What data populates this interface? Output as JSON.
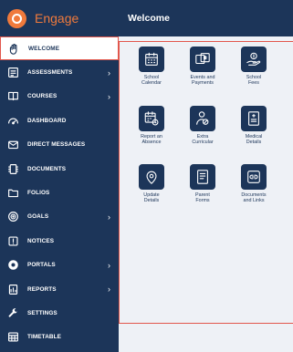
{
  "app": {
    "name": "Engage",
    "brand_color": "#f07a3c",
    "nav_color": "#1c3559",
    "highlight_color": "#e2574c"
  },
  "header": {
    "title": "Welcome"
  },
  "sidebar": {
    "items": [
      {
        "label": "WELCOME",
        "icon": "hand-wave-icon",
        "active": true
      },
      {
        "label": "ASSESSMENTS",
        "icon": "assessment-icon",
        "chevron": true
      },
      {
        "label": "COURSES",
        "icon": "book-icon",
        "chevron": true
      },
      {
        "label": "DASHBOARD",
        "icon": "gauge-icon"
      },
      {
        "label": "DIRECT MESSAGES",
        "icon": "mail-icon"
      },
      {
        "label": "DOCUMENTS",
        "icon": "documents-icon"
      },
      {
        "label": "FOLIOS",
        "icon": "folder-icon"
      },
      {
        "label": "GOALS",
        "icon": "target-icon",
        "chevron": true
      },
      {
        "label": "NOTICES",
        "icon": "notice-icon"
      },
      {
        "label": "PORTALS",
        "icon": "portal-icon",
        "chevron": true
      },
      {
        "label": "REPORTS",
        "icon": "report-icon",
        "chevron": true
      },
      {
        "label": "SETTINGS",
        "icon": "wrench-icon"
      },
      {
        "label": "TIMETABLE",
        "icon": "timetable-icon"
      }
    ]
  },
  "tiles": [
    {
      "label": "School\nCalendar",
      "icon": "calendar-icon"
    },
    {
      "label": "Events and\nPayments",
      "icon": "tickets-icon"
    },
    {
      "label": "School\nFees",
      "icon": "money-hand-icon"
    },
    {
      "label": "Report an\nAbsence",
      "icon": "calendar-clock-icon"
    },
    {
      "label": "Extra\nCurricular",
      "icon": "person-edit-icon"
    },
    {
      "label": "Medical\nDetails",
      "icon": "medical-id-icon"
    },
    {
      "label": "Update\nDetails",
      "icon": "location-pin-icon"
    },
    {
      "label": "Parent\nForms",
      "icon": "form-icon"
    },
    {
      "label": "Documents\nand Links",
      "icon": "link-icon"
    }
  ]
}
